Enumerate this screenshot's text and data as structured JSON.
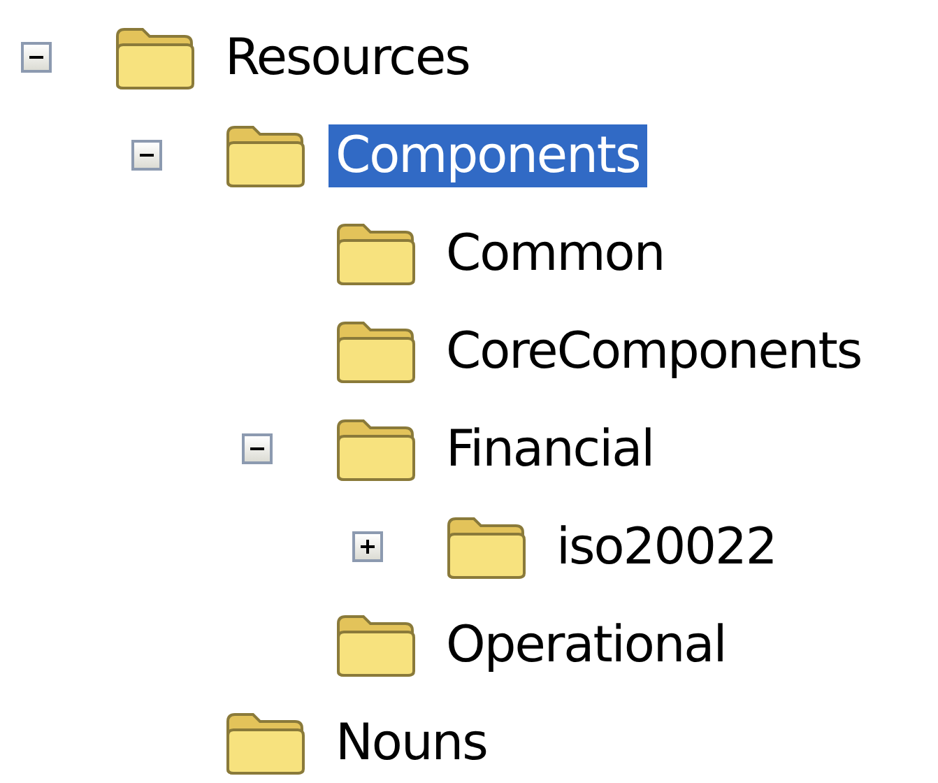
{
  "tree": {
    "items": [
      {
        "label": "Resources",
        "selected": false,
        "expanded": true,
        "children": [
          {
            "label": "Components",
            "selected": true,
            "expanded": true,
            "children": [
              {
                "label": "Common",
                "selected": false
              },
              {
                "label": "CoreComponents",
                "selected": false
              },
              {
                "label": "Financial",
                "selected": false,
                "expanded": true,
                "children": [
                  {
                    "label": "iso20022",
                    "selected": false,
                    "expanded": false
                  }
                ]
              },
              {
                "label": "Operational",
                "selected": false
              }
            ]
          },
          {
            "label": "Nouns",
            "selected": false
          }
        ]
      }
    ]
  }
}
